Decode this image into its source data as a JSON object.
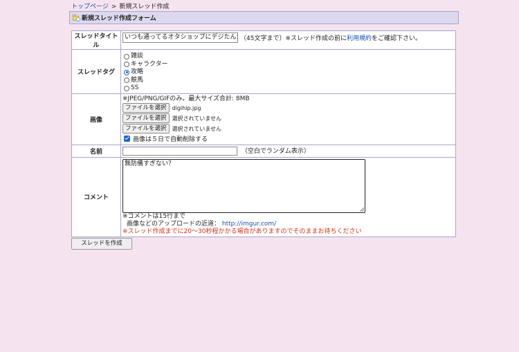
{
  "breadcrumb": {
    "home_link": "トップページ",
    "separator": ">",
    "current": "新規スレッド作成"
  },
  "header": {
    "icon": "folder-new-icon",
    "title": "新規スレッド作成フォーム"
  },
  "form": {
    "title_row": {
      "label": "スレッドタイトル",
      "input_value": "いつも通ってるオタショップにデジたんがいた",
      "note_prefix": "（45文字まで）※スレッド作成の前に",
      "terms_link": "利用規約",
      "note_suffix": "をご確認下さい。"
    },
    "tags_row": {
      "label": "スレッドタグ",
      "options": [
        {
          "label": "雑談",
          "checked": false
        },
        {
          "label": "キャラクター",
          "checked": false
        },
        {
          "label": "攻略",
          "checked": true
        },
        {
          "label": "競馬",
          "checked": false
        },
        {
          "label": "SS",
          "checked": false
        }
      ]
    },
    "image_row": {
      "label": "画像",
      "note": "※JPEG/PNG/GIFのみ。最大サイズ合計: 8MB",
      "files": [
        {
          "button": "ファイルを選択",
          "filename": "digihip.jpg"
        },
        {
          "button": "ファイルを選択",
          "filename": "選択されていません"
        },
        {
          "button": "ファイルを選択",
          "filename": "選択されていません"
        }
      ],
      "auto_delete_label": "画像は５日で自動削除する",
      "auto_delete_checked": true
    },
    "name_row": {
      "label": "名前",
      "input_value": "",
      "note": "（空白でランダム表示）"
    },
    "comment_row": {
      "label": "コメント",
      "text": "無防備すぎない？",
      "note_lines": "※コメントは15行まで",
      "note_upload_prefix": "画像などのアップロードの近道：",
      "upload_link": "http://imgur.com/",
      "warning": "※スレッド作成までに20～30秒程かかる場合がありますのでそのままお待ちください"
    }
  },
  "submit_label": "スレッドを作成",
  "colors": {
    "page_bg": "#f5e4ef",
    "header_bg": "#dcd9ef",
    "border": "#a9a4cf",
    "link": "#1a4fa8",
    "warning": "#d0301a",
    "accent": "#1a66c9"
  }
}
